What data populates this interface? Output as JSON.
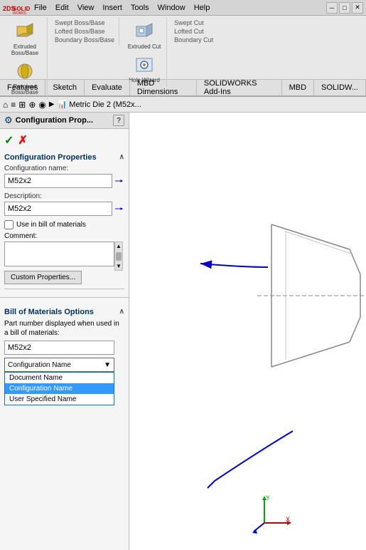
{
  "app": {
    "title": "SolidWorks",
    "logo_text": "SOLIDWORKS"
  },
  "menu": {
    "items": [
      "File",
      "Edit",
      "View",
      "Insert",
      "Tools",
      "Window",
      "Help"
    ]
  },
  "toolbar": {
    "groups": [
      {
        "buttons": [
          {
            "label": "Extruded Boss/Base",
            "icon": "extrude-icon"
          },
          {
            "label": "Revolved Boss/Base",
            "icon": "revolve-icon"
          }
        ]
      },
      {
        "buttons": [
          {
            "label": "Swept Boss/Base",
            "icon": "swept-icon"
          },
          {
            "label": "Lofted Boss/Base",
            "icon": "lofted-icon"
          },
          {
            "label": "Boundary Boss/Base",
            "icon": "boundary-icon"
          }
        ]
      },
      {
        "buttons": [
          {
            "label": "Extruded Cut",
            "icon": "extruded-cut-icon"
          },
          {
            "label": "Hole Wizard",
            "icon": "hole-wizard-icon"
          }
        ]
      },
      {
        "buttons": [
          {
            "label": "Swept Cut",
            "icon": "swept-cut-icon"
          },
          {
            "label": "Lofted Cut",
            "icon": "lofted-cut-icon"
          },
          {
            "label": "Boundary Cut",
            "icon": "boundary-cut-icon"
          }
        ]
      }
    ]
  },
  "tabs": {
    "items": [
      "Features",
      "Sketch",
      "Evaluate",
      "MBD Dimensions",
      "SOLIDWORKS Add-Ins",
      "MBD",
      "SOLIDW..."
    ]
  },
  "secondary_toolbar": {
    "breadcrumb": "Metric Die 2 (M52x..."
  },
  "panel": {
    "title": "Configuration Prop...",
    "help_icon": "?",
    "sections": {
      "config_properties": {
        "title": "Configuration Properties",
        "config_name_label": "Configuration name:",
        "config_name_value": "M52x2",
        "description_label": "Description:",
        "description_value": "M52x2",
        "use_in_bom_label": "Use in bill of materials",
        "use_in_bom_checked": false,
        "comment_label": "Comment:",
        "comment_value": "",
        "custom_props_btn": "Custom Properties..."
      },
      "bom_options": {
        "title": "Bill of Materials Options",
        "part_number_desc": "Part number displayed when used in a bill of materials:",
        "part_number_value": "M52x2",
        "dropdown_selected": "Configuration Name",
        "dropdown_options": [
          "Document Name",
          "Configuration Name",
          "User Specified Name"
        ]
      }
    },
    "actions": {
      "confirm": "✓",
      "cancel": "✗"
    }
  },
  "canvas": {
    "background": "#ffffff"
  }
}
